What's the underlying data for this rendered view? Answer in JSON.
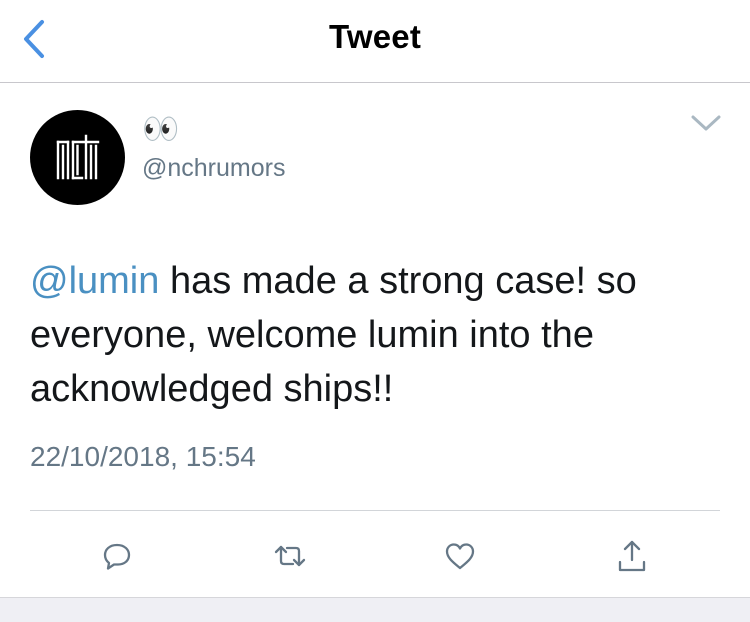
{
  "nav": {
    "title": "Tweet",
    "back_icon": "chevron-left-icon"
  },
  "tweet": {
    "display_name": "👀",
    "username": "@nchrumors",
    "avatar_icon": "nct-logo-avatar",
    "menu_icon": "chevron-down-icon",
    "mention": "@lumin",
    "body": " has made a strong case! so everyone, welcome lumin into the acknowledged ships!!",
    "timestamp": "22/10/2018, 15:54"
  },
  "actions": [
    {
      "name": "reply",
      "icon": "reply-icon"
    },
    {
      "name": "retweet",
      "icon": "retweet-icon"
    },
    {
      "name": "like",
      "icon": "heart-icon"
    },
    {
      "name": "share",
      "icon": "share-icon"
    }
  ],
  "colors": {
    "accent": "#1da1f2",
    "mention": "#4a90c2",
    "secondary_text": "#657786",
    "icon_gray": "#657786"
  }
}
